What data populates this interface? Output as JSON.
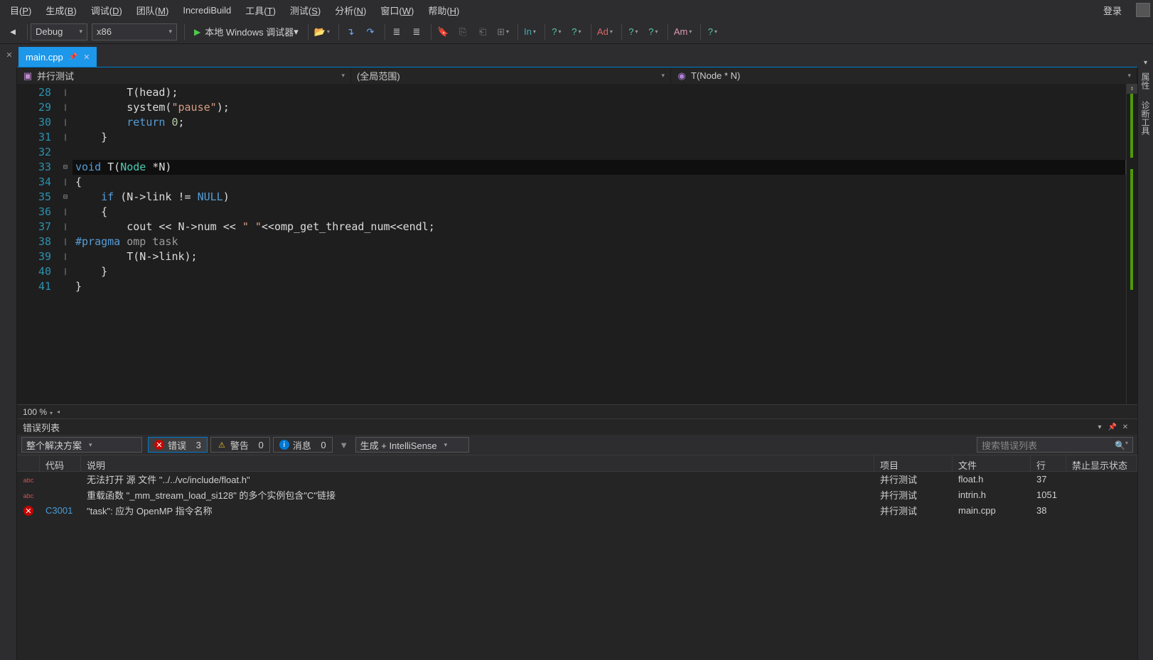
{
  "menu": {
    "items": [
      "目(P)",
      "生成(B)",
      "调试(D)",
      "团队(M)",
      "IncrediBuild",
      "工具(T)",
      "测试(S)",
      "分析(N)",
      "窗口(W)",
      "帮助(H)"
    ],
    "login": "登录"
  },
  "toolbar": {
    "config": "Debug",
    "platform": "x86",
    "debugger": "本地 Windows 调试器"
  },
  "tab": {
    "name": "main.cpp"
  },
  "nav": {
    "project": "并行测试",
    "scope": "(全局范围)",
    "member": "T(Node * N)"
  },
  "code": {
    "start": 28,
    "lines": [
      {
        "n": 28,
        "fold": "|",
        "html": "        T(head);"
      },
      {
        "n": 29,
        "fold": "|",
        "html": "        system(<span class='tok-str'>\"pause\"</span>);"
      },
      {
        "n": 30,
        "fold": "|",
        "html": "        <span class='tok-kw'>return</span> <span class='tok-num'>0</span>;"
      },
      {
        "n": 31,
        "fold": "|",
        "html": "    }"
      },
      {
        "n": 32,
        "fold": "",
        "html": ""
      },
      {
        "n": 33,
        "fold": "⊟",
        "hl": true,
        "html": "<span class='tok-kw'>void</span> T(<span class='tok-type'>Node</span> *N)"
      },
      {
        "n": 34,
        "fold": "|",
        "html": "{"
      },
      {
        "n": 35,
        "fold": "⊟",
        "html": "    <span class='tok-kw'>if</span> (N-&gt;link != <span class='tok-kw'>NULL</span>)"
      },
      {
        "n": 36,
        "fold": "|",
        "html": "    {"
      },
      {
        "n": 37,
        "fold": "|",
        "html": "        cout &lt;&lt; N-&gt;num &lt;&lt; <span class='tok-str'>\" \"</span>&lt;&lt;omp_get_thread_num&lt;&lt;endl;"
      },
      {
        "n": 38,
        "fold": "|",
        "html": "<span class='tok-dir'>#pragma</span> <span class='tok-macro'>omp task</span>"
      },
      {
        "n": 39,
        "fold": "|",
        "html": "        T(N-&gt;link);"
      },
      {
        "n": 40,
        "fold": "|",
        "html": "    }"
      },
      {
        "n": 41,
        "fold": "",
        "html": "}"
      }
    ]
  },
  "zoom": "100 %",
  "rightTabs": [
    "属性",
    "诊断工具"
  ],
  "errorPanel": {
    "title": "错误列表",
    "scope": "整个解决方案",
    "filters": {
      "errLabel": "错误",
      "errCount": 3,
      "warnLabel": "警告",
      "warnCount": 0,
      "infoLabel": "消息",
      "infoCount": 0
    },
    "build": "生成 + IntelliSense",
    "searchPlaceholder": "搜索错误列表",
    "cols": {
      "code": "代码",
      "desc": "说明",
      "proj": "项目",
      "file": "文件",
      "line": "行",
      "supp": "禁止显示状态"
    },
    "rows": [
      {
        "kind": "intelli",
        "code": "",
        "desc": "无法打开 源 文件 \"../../vc/include/float.h\"",
        "proj": "并行测试",
        "file": "float.h",
        "line": "37"
      },
      {
        "kind": "intelli",
        "code": "",
        "desc": "重载函数 \"_mm_stream_load_si128\" 的多个实例包含\"C\"链接",
        "proj": "并行测试",
        "file": "intrin.h",
        "line": "1051"
      },
      {
        "kind": "error",
        "code": "C3001",
        "desc": "\"task\": 应为 OpenMP 指令名称",
        "proj": "并行测试",
        "file": "main.cpp",
        "line": "38"
      }
    ]
  }
}
